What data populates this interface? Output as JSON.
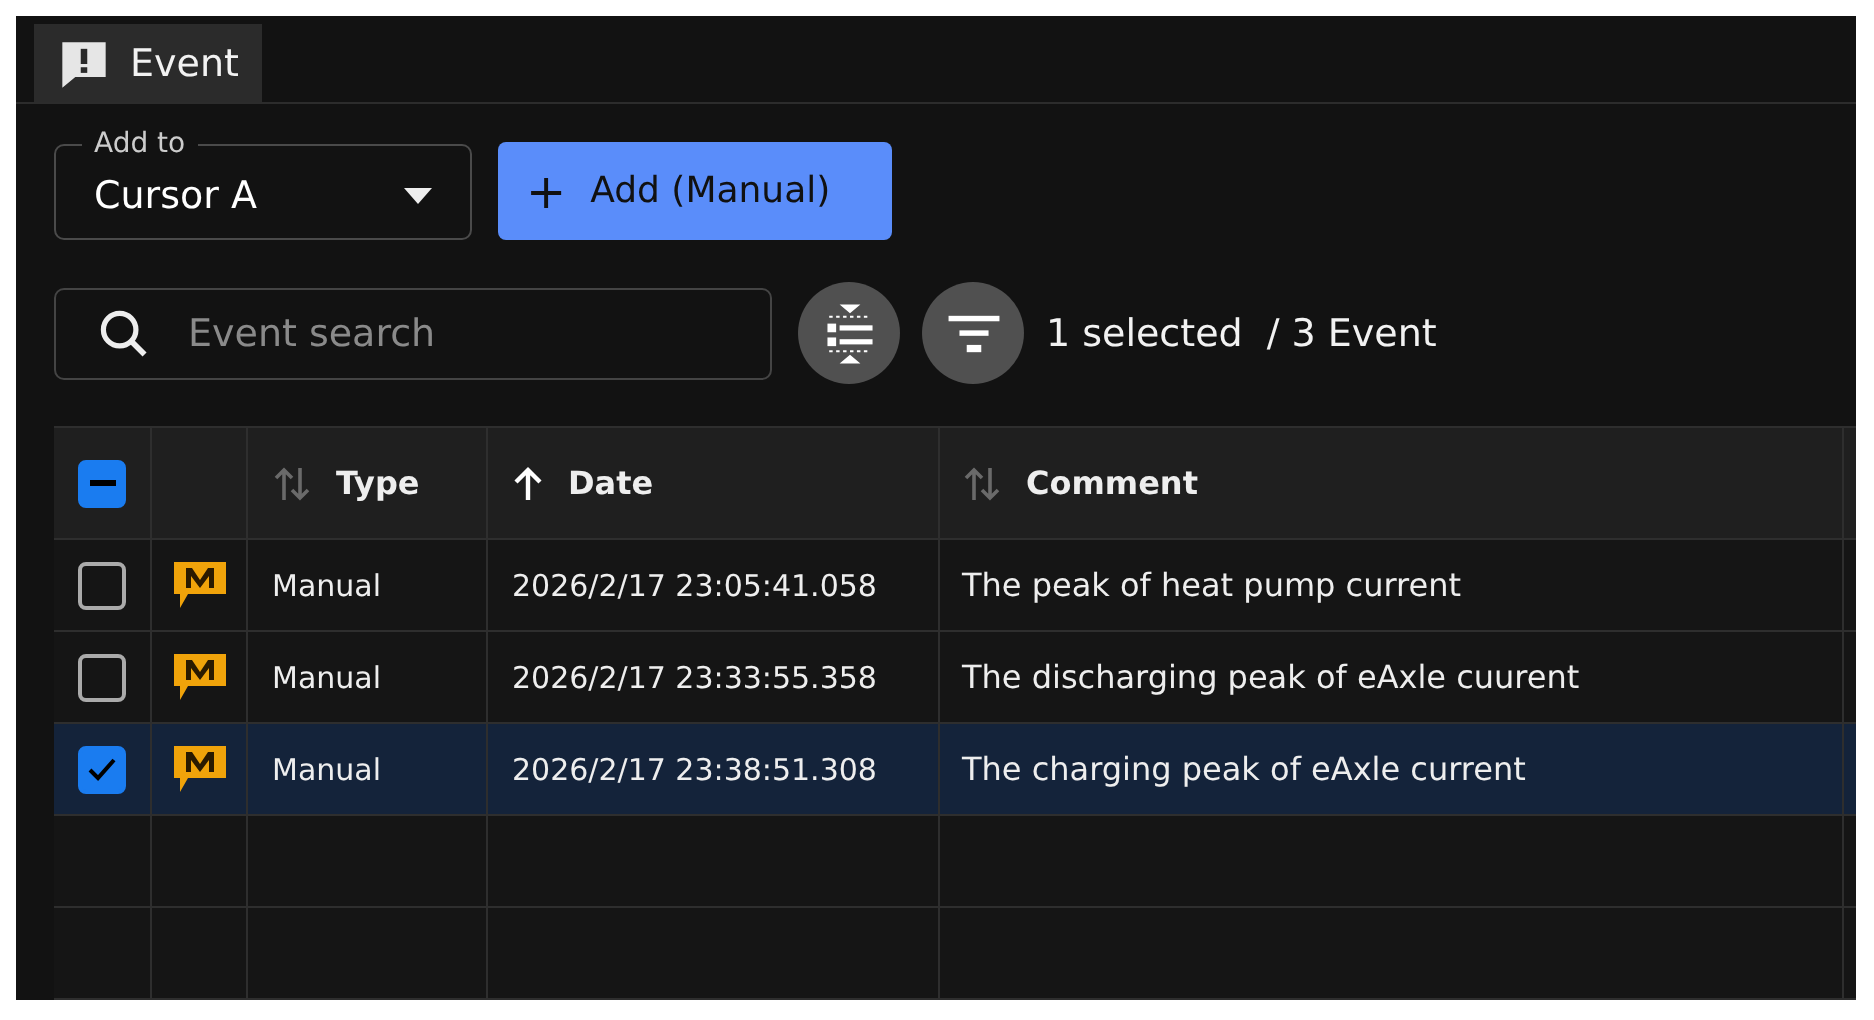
{
  "tab": {
    "label": "Event",
    "selected": true
  },
  "add_to": {
    "label": "Add to",
    "value": "Cursor A"
  },
  "add_button": {
    "icon": "+",
    "label": "Add (Manual)"
  },
  "search": {
    "placeholder": "Event search"
  },
  "selection_count": "1 selected",
  "total_count": "/ 3 Event",
  "table": {
    "select_all": {
      "indeterminate": true
    },
    "columns": [
      {
        "label": "Type",
        "sorted_ascending": false
      },
      {
        "label": "Date",
        "sorted_ascending": true
      },
      {
        "label": "Comment",
        "sorted_ascending": false
      }
    ],
    "rows": [
      {
        "selected": false,
        "type": "Manual",
        "date": "2026/2/17 23:05:41.058",
        "comment": "The peak of heat pump current"
      },
      {
        "selected": false,
        "type": "Manual",
        "date": "2026/2/17 23:33:55.358",
        "comment": "The discharging peak of eAxle cuurent"
      },
      {
        "selected": true,
        "type": "Manual",
        "date": "2026/2/17 23:38:51.308",
        "comment": "The charging peak of eAxle current"
      }
    ]
  }
}
